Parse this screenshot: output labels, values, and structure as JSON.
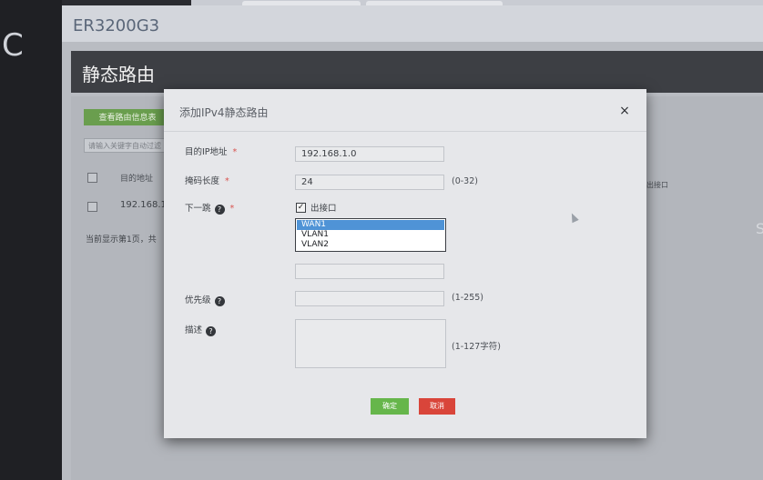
{
  "app": {
    "brand": "ER3200G3"
  },
  "page": {
    "title": "静态路由"
  },
  "background_list": {
    "add_button": "查看路由信息表",
    "search_placeholder": "请输入关键字自动过滤",
    "column_dest": "目的地址",
    "row1_dest": "192.168.1",
    "pager_text": "当前显示第1页，共",
    "right_column": "出接口",
    "right_glyph": "S"
  },
  "left_glyph": "C",
  "modal": {
    "title": "添加IPv4静态路由",
    "close_icon": "close-icon",
    "close_glyph": "×",
    "fields": {
      "dest_ip": {
        "label": "目的IP地址",
        "required": "*",
        "value": "192.168.1.0"
      },
      "mask_len": {
        "label": "掩码长度",
        "required": "*",
        "value": "24",
        "hint": "(0-32)"
      },
      "next_hop": {
        "label": "下一跳",
        "required": "*",
        "checkbox_label": "出接口",
        "checked": true,
        "options": [
          "WAN1",
          "VLAN1",
          "VLAN2"
        ],
        "selected": "WAN1",
        "extra_value": ""
      },
      "priority": {
        "label": "优先级",
        "value": "",
        "hint": "(1-255)"
      },
      "description": {
        "label": "描述",
        "value": "",
        "hint": "(1-127字符)"
      }
    },
    "buttons": {
      "ok": "确定",
      "cancel": "取消"
    }
  },
  "colors": {
    "ok": "#66b64b",
    "cancel": "#d9453a",
    "selected_option": "#4f93d6",
    "required": "#d9534f"
  }
}
